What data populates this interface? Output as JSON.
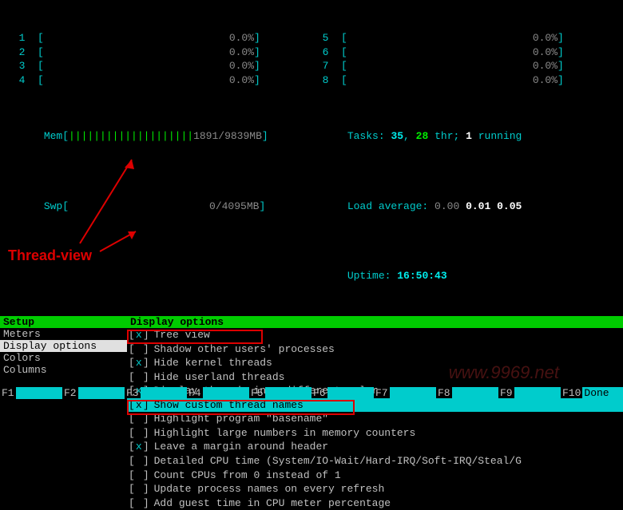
{
  "cpu_meters_left": [
    {
      "id": "1",
      "pct": "0.0%"
    },
    {
      "id": "2",
      "pct": "0.0%"
    },
    {
      "id": "3",
      "pct": "0.0%"
    },
    {
      "id": "4",
      "pct": "0.0%"
    }
  ],
  "cpu_meters_right": [
    {
      "id": "5",
      "pct": "0.0%"
    },
    {
      "id": "6",
      "pct": "0.0%"
    },
    {
      "id": "7",
      "pct": "0.0%"
    },
    {
      "id": "8",
      "pct": "0.0%"
    }
  ],
  "mem": {
    "label": "Mem",
    "bars": "||||||||||||||||||||",
    "value": "1891/9839MB"
  },
  "swp": {
    "label": "Swp",
    "value": "0/4095MB"
  },
  "tasks": {
    "label": "Tasks:",
    "procs": "35",
    "sep1": ",",
    "thr": "28",
    "thr_label": "thr;",
    "running": "1",
    "running_label": "running"
  },
  "loadavg": {
    "label": "Load average:",
    "v1": "0.00",
    "v2": "0.01",
    "v3": "0.05"
  },
  "uptime": {
    "label": "Uptime:",
    "value": "16:50:43"
  },
  "setup": {
    "title": "Setup",
    "items": [
      {
        "label": "Meters",
        "selected": false
      },
      {
        "label": "Display options",
        "selected": true
      },
      {
        "label": "Colors",
        "selected": false
      },
      {
        "label": "Columns",
        "selected": false
      }
    ]
  },
  "options": {
    "title": "Display options",
    "items": [
      {
        "checked": true,
        "label": "Tree view",
        "highlighted": false,
        "boxed": true
      },
      {
        "checked": false,
        "label": "Shadow other users' processes"
      },
      {
        "checked": true,
        "label": "Hide kernel threads"
      },
      {
        "checked": false,
        "label": "Hide userland threads"
      },
      {
        "checked": true,
        "label": "Display threads in a different color"
      },
      {
        "checked": true,
        "label": "Show custom thread names",
        "highlighted": true,
        "boxed": true
      },
      {
        "checked": false,
        "label": "Highlight program \"basename\""
      },
      {
        "checked": false,
        "label": "Highlight large numbers in memory counters"
      },
      {
        "checked": true,
        "label": "Leave a margin around header"
      },
      {
        "checked": false,
        "label": "Detailed CPU time (System/IO-Wait/Hard-IRQ/Soft-IRQ/Steal/G"
      },
      {
        "checked": false,
        "label": "Count CPUs from 0 instead of 1"
      },
      {
        "checked": false,
        "label": "Update process names on every refresh"
      },
      {
        "checked": false,
        "label": "Add guest time in CPU meter percentage"
      }
    ]
  },
  "annotation_text": "Thread-view",
  "fkeys": [
    {
      "n": "F1",
      "label": ""
    },
    {
      "n": "F2",
      "label": ""
    },
    {
      "n": "F3",
      "label": ""
    },
    {
      "n": "F4",
      "label": ""
    },
    {
      "n": "F5",
      "label": ""
    },
    {
      "n": "F6",
      "label": ""
    },
    {
      "n": "F7",
      "label": ""
    },
    {
      "n": "F8",
      "label": ""
    },
    {
      "n": "F9",
      "label": ""
    },
    {
      "n": "F10",
      "label": "Done"
    }
  ],
  "watermark": "www.9969.net"
}
